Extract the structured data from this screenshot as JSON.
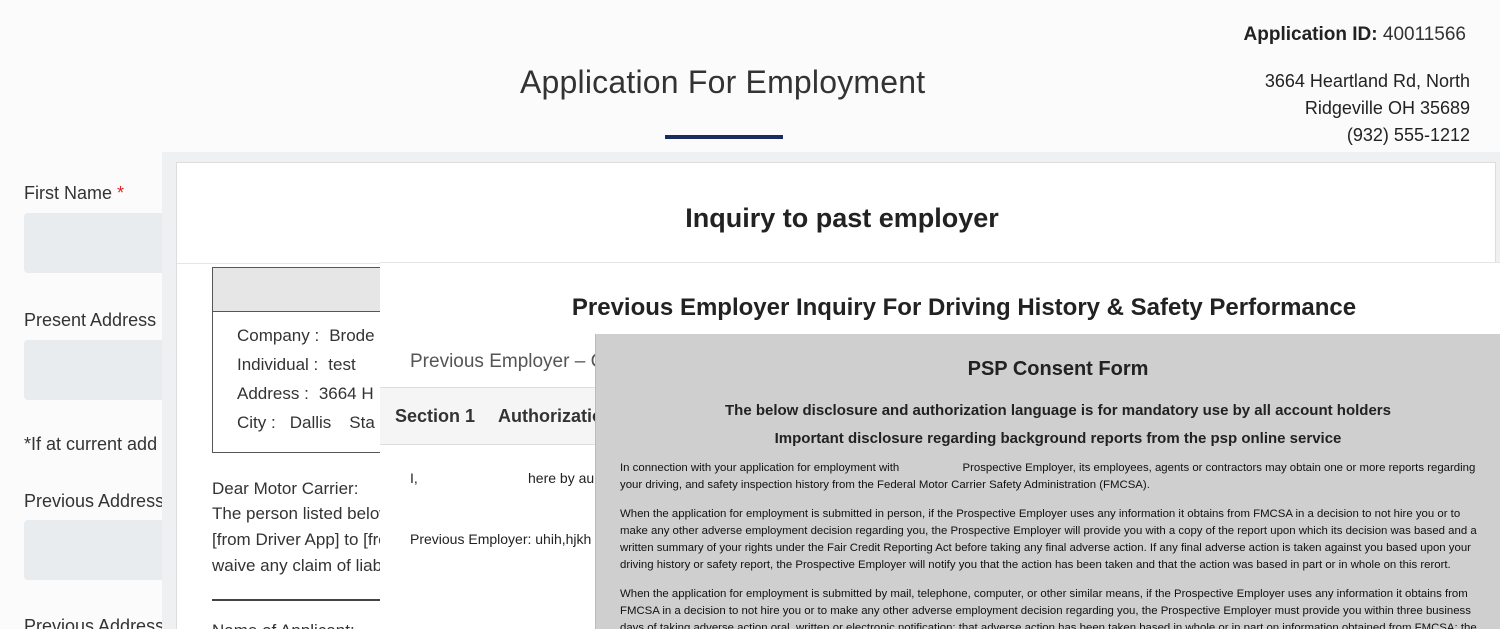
{
  "header": {
    "title": "Application For Employment",
    "application_id_label": "Application ID:",
    "application_id_value": "40011566",
    "address_line1": "3664 Heartland Rd, North",
    "address_line2": "Ridgeville OH 35689",
    "phone": "(932) 555-1212"
  },
  "form": {
    "first_name_label": "First Name",
    "required_mark": "*",
    "present_address_label": "Present Address",
    "current_address_note": "*If at current add",
    "previous_address_label": "Previous Address",
    "previous_address_label2": "Previous Address"
  },
  "inquiry_modal": {
    "title": "Inquiry to past employer",
    "company_label": "Company :",
    "company_value": "Brode",
    "individual_label": "Individual :",
    "individual_value": "test",
    "address_label": "Address :",
    "address_value": "3664 H",
    "city_label": "City :",
    "city_value": "Dallis",
    "state_partial": "Sta",
    "letter_greeting": "Dear Motor Carrier:",
    "letter_line1": "The person listed below",
    "letter_line2": "[from Driver App] to [fro",
    "letter_line3": "waive any claim of liability agaist your company for r",
    "name_of_applicant": "Name of Applicant:"
  },
  "history_modal": {
    "title": "Previous Employer Inquiry For Driving History & Safety Performance",
    "subtitle": "Previous Employer – C",
    "section_label": "Section 1",
    "section_tab": "Authorizatio",
    "authorize_prefix": "I,",
    "authorize_text": "here by au",
    "previous_employer": "Previous Employer: uhih,hjkh"
  },
  "psp_modal": {
    "title": "PSP Consent Form",
    "subtitle1": "The below disclosure and authorization language is for mandatory use by all account holders",
    "subtitle2": "Important disclosure regarding background reports from the psp online service",
    "para1_line1": "In connection with your application for employment with                    Prospective Employer, its employees, agents or contractors may obtain one or more reports regarding",
    "para1_line2": "your driving, and safety inspection history from the Federal Motor Carrier Safety Administration (FMCSA).",
    "para2_line1": "When the application for employment is submitted in person, if the Prospective Employer uses any information it obtains from FMCSA in a decision to not hire you or to",
    "para2_line2": "make any other adverse employment decision regarding you, the Prospective Employer will provide you with a copy of the report upon which its decision was based and a",
    "para2_line3": "written summary of your rights under the Fair Credit Reporting Act before taking any final adverse action. If any final adverse action is taken against you based upon your",
    "para2_line4": "driving history or safety report, the Prospective Employer will notify you that the action has been taken and that the action was based in part or in whole on this rerort.",
    "para3_line1": "When the application for employment is submitted by mail, telephone, computer, or other similar means, if the Prospective Employer uses any information it obtains from",
    "para3_line2": "FMCSA in a decision to not hire you or to make any other adverse employment decision regarding you, the Prospective Employer must provide you within three business",
    "para3_line3": "days of taking adverse action oral, written or electronic notification: that adverse action has been taken based in whole or in part on information obtained from FMCSA; the"
  }
}
